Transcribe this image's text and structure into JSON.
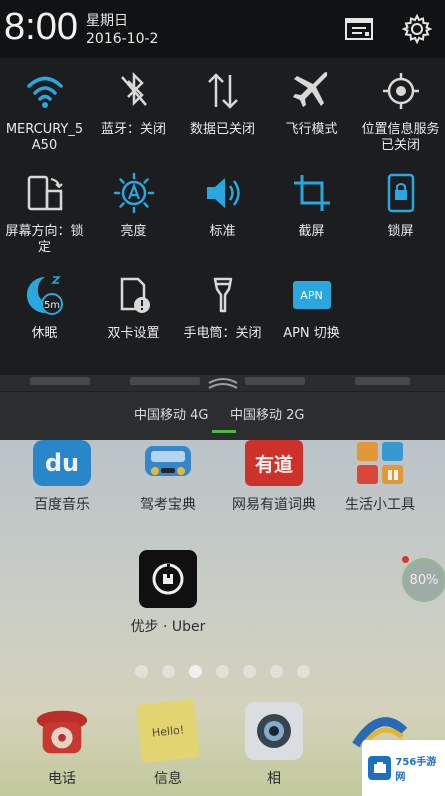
{
  "status_bar": {
    "time": "8:00",
    "weekday": "星期日",
    "date": "2016-10-2",
    "icons": [
      "notification-settings-icon",
      "gear-icon"
    ]
  },
  "quick_settings": [
    {
      "icon": "wifi-icon",
      "label": "MERCURY_5A50",
      "active": true
    },
    {
      "icon": "bluetooth-icon",
      "label": "蓝牙：关闭",
      "active": false
    },
    {
      "icon": "mobile-data-icon",
      "label": "数据已关闭",
      "active": false
    },
    {
      "icon": "airplane-icon",
      "label": "飞行模式",
      "active": false
    },
    {
      "icon": "location-icon",
      "label": "位置信息服务已关闭",
      "active": false
    },
    {
      "icon": "screen-rotation-icon",
      "label": "屏幕方向：锁定",
      "active": false
    },
    {
      "icon": "brightness-auto-icon",
      "label": "亮度",
      "active": true
    },
    {
      "icon": "volume-icon",
      "label": "标准",
      "active": true
    },
    {
      "icon": "screenshot-crop-icon",
      "label": "截屏",
      "active": true
    },
    {
      "icon": "lock-screen-icon",
      "label": "锁屏",
      "active": true
    },
    {
      "icon": "sleep-moon-icon",
      "label": "休眠",
      "active": true,
      "badge": "5m"
    },
    {
      "icon": "dual-sim-icon",
      "label": "双卡设置",
      "active": false
    },
    {
      "icon": "flashlight-icon",
      "label": "手电筒：关闭",
      "active": false
    },
    {
      "icon": "apn-icon",
      "label": "APN 切换",
      "active": true,
      "badge": "APN"
    }
  ],
  "carriers": [
    "中国移动 4G",
    "中国移动 2G"
  ],
  "home": {
    "apps_row1": [
      {
        "label": "百度音乐",
        "icon": "baidu-music-icon"
      },
      {
        "label": "驾考宝典",
        "icon": "car-icon"
      },
      {
        "label": "网易有道词典",
        "icon": "youdao-icon",
        "glyph": "有道"
      },
      {
        "label": "生活小工具",
        "icon": "tools-icon"
      }
    ],
    "apps_row2": [
      {
        "label": "优步 · Uber",
        "icon": "uber-icon"
      }
    ],
    "dock": [
      {
        "label": "电话",
        "icon": "phone-icon"
      },
      {
        "label": "信息",
        "icon": "message-icon",
        "glyph": "Hello!"
      },
      {
        "label": "相",
        "icon": "camera-icon"
      },
      {
        "label": "",
        "icon": "browser-icon"
      }
    ],
    "baidu_glyph": "du",
    "cleaner_percent": "80%",
    "page_count": 7,
    "active_page": 3
  },
  "watermark": {
    "text": "756手游网"
  },
  "colors": {
    "accent": "#2aa7df",
    "carrier_indicator": "#4cbb3f"
  }
}
